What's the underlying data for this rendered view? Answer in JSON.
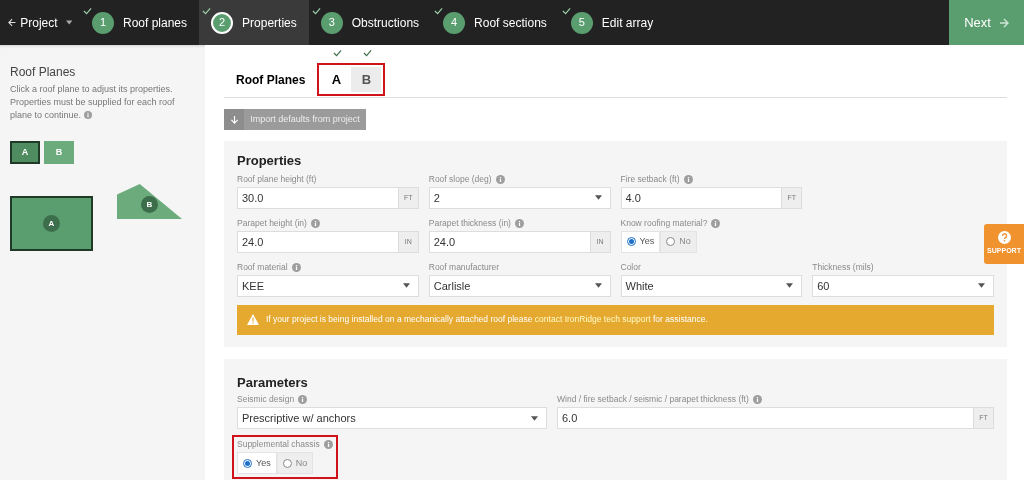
{
  "top_bar": {
    "project_menu": "Project",
    "steps": [
      {
        "number": "1",
        "label": "Roof planes",
        "completed": true,
        "selected": false
      },
      {
        "number": "2",
        "label": "Properties",
        "completed": true,
        "selected": true
      },
      {
        "number": "3",
        "label": "Obstructions",
        "completed": true,
        "selected": false
      },
      {
        "number": "4",
        "label": "Roof sections",
        "completed": true,
        "selected": false
      },
      {
        "number": "5",
        "label": "Edit array",
        "completed": true,
        "selected": false
      }
    ],
    "next_button": "Next"
  },
  "sidebar": {
    "title": "Roof Planes",
    "description": "Click a roof plane to adjust its properties. Properties must be supplied for each roof plane to continue.",
    "info": true,
    "plane_buttons": [
      {
        "label": "A",
        "selected": true
      },
      {
        "label": "B",
        "selected": false
      }
    ],
    "plane_drawing": [
      {
        "label": "A",
        "kind": "rectangle",
        "selected": true
      },
      {
        "label": "B",
        "kind": "pentagon",
        "selected": false
      }
    ]
  },
  "roof_planes_tabs": {
    "title": "Roof Planes",
    "highlighted": true,
    "tabs": [
      {
        "label": "A",
        "selected": true,
        "completed": true
      },
      {
        "label": "B",
        "selected": false,
        "completed": true
      }
    ]
  },
  "import_button": "Import defaults from project",
  "properties": {
    "title": "Properties",
    "rows": [
      [
        {
          "kind": "input",
          "label": "Roof plane height (ft)",
          "info": false,
          "value": "30.0",
          "unit": "FT"
        },
        {
          "kind": "select",
          "label": "Roof slope (deg)",
          "info": true,
          "value": "2"
        },
        {
          "kind": "input",
          "label": "Fire setback (ft)",
          "info": true,
          "value": "4.0",
          "unit": "FT"
        }
      ],
      [
        {
          "kind": "input",
          "label": "Parapet height (in)",
          "info": true,
          "value": "24.0",
          "unit": "IN"
        },
        {
          "kind": "input",
          "label": "Parapet thickness (in)",
          "info": true,
          "value": "24.0",
          "unit": "IN"
        },
        {
          "kind": "radio",
          "label": "Know roofing material?",
          "info": true,
          "options": [
            {
              "label": "Yes",
              "selected": true
            },
            {
              "label": "No",
              "selected": false
            }
          ]
        }
      ],
      [
        {
          "kind": "select",
          "label": "Roof material",
          "info": true,
          "value": "KEE"
        },
        {
          "kind": "select",
          "label": "Roof manufacturer",
          "info": false,
          "value": "Carlisle"
        },
        {
          "kind": "select",
          "label": "Color",
          "info": false,
          "value": "White"
        },
        {
          "kind": "select",
          "label": "Thickness (mils)",
          "info": false,
          "value": "60"
        }
      ]
    ],
    "warning": {
      "text_before": "If your project is being installed on a mechanically attached roof please",
      "link": "contact IronRidge tech support",
      "text_after": "for assistance."
    }
  },
  "parameters": {
    "title": "Parameters",
    "rows": [
      [
        {
          "kind": "select",
          "label": "Seismic design",
          "info": true,
          "value": "Prescriptive w/ anchors"
        },
        {
          "kind": "input",
          "label": "Wind / fire setback / seismic / parapet thickness (ft)",
          "info": true,
          "value": "6.0",
          "unit": "FT"
        }
      ],
      [
        {
          "kind": "radio",
          "label": "Supplemental chassis",
          "info": true,
          "highlighted": true,
          "options": [
            {
              "label": "Yes",
              "selected": true
            },
            {
              "label": "No",
              "selected": false
            }
          ]
        }
      ]
    ]
  },
  "support_button": "SUPPORT"
}
